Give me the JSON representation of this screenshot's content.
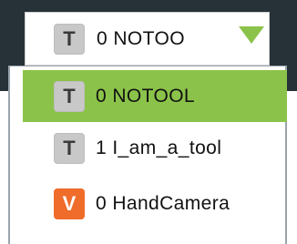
{
  "combo": {
    "badge": "T",
    "value": "0 NOTOO",
    "arrow_icon": "triangle-down-icon"
  },
  "options": [
    {
      "badge": "T",
      "label": "0 NOTOOL",
      "badge_color": "#c8c8c8",
      "selected": true
    },
    {
      "badge": "T",
      "label": "1 I_am_a_tool",
      "badge_color": "#c8c8c8",
      "selected": false
    },
    {
      "badge": "V",
      "label": "0 HandCamera",
      "badge_color": "#ef6c2a",
      "selected": false
    }
  ],
  "colors": {
    "accent_green": "#8bc34a",
    "dark_background": "#263238",
    "orange_badge": "#ef6c2a",
    "gray_badge": "#c8c8c8"
  }
}
